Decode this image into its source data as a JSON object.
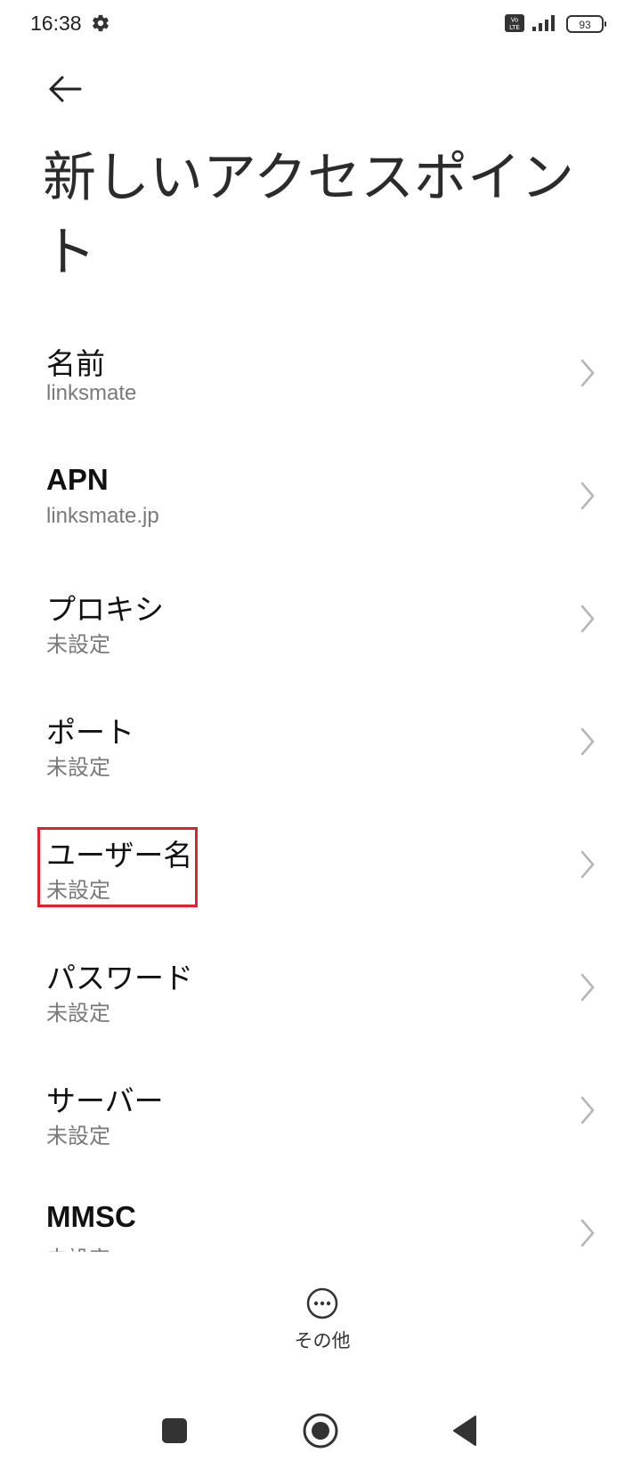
{
  "status_bar": {
    "time": "16:38",
    "battery": "93",
    "icons": [
      "gear-icon",
      "volte-icon",
      "signal-icon",
      "battery-icon"
    ]
  },
  "header": {
    "back_icon": "arrow-left-icon",
    "title": "新しいアクセスポイント"
  },
  "settings": [
    {
      "label": "名前",
      "value": "linksmate"
    },
    {
      "label": "APN",
      "value": "linksmate.jp"
    },
    {
      "label": "プロキシ",
      "value": "未設定"
    },
    {
      "label": "ポート",
      "value": "未設定"
    },
    {
      "label": "ユーザー名",
      "value": "未設定"
    },
    {
      "label": "パスワード",
      "value": "未設定"
    },
    {
      "label": "サーバー",
      "value": "未設定"
    },
    {
      "label": "MMSC",
      "value": "未設定"
    }
  ],
  "bottom_action": {
    "label": "その他",
    "icon": "more-circle-icon"
  },
  "colors": {
    "highlight": "#e0202a",
    "secondary_text": "#7a7a7a",
    "chevron": "#b5b5b5"
  }
}
